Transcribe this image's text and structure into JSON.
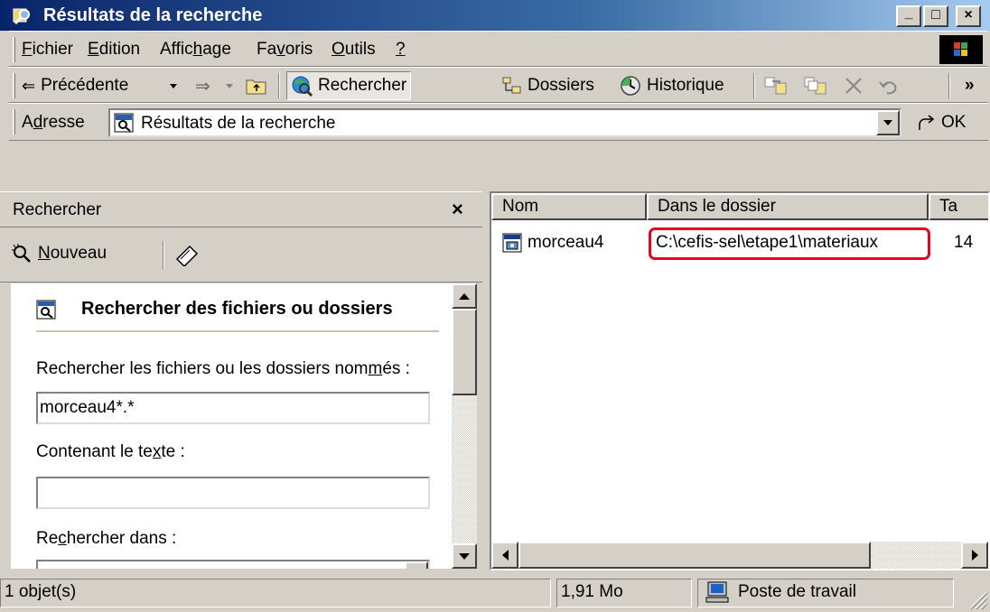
{
  "window": {
    "title": "Résultats de la recherche",
    "controls": {
      "minimize": "_",
      "maximize": "□",
      "close": "×"
    }
  },
  "menu": {
    "items": [
      {
        "accel": "F",
        "rest": "ichier"
      },
      {
        "accel": "E",
        "rest": "dition"
      },
      {
        "before": "Affic",
        "accel": "h",
        "rest": "age"
      },
      {
        "before": "Fa",
        "accel": "v",
        "rest": "oris"
      },
      {
        "accel": "O",
        "rest": "utils"
      },
      {
        "accel": "?",
        "rest": ""
      }
    ]
  },
  "toolbar": {
    "back_label": "Précédente",
    "search_label": "Rechercher",
    "folders_label": "Dossiers",
    "history_label": "Historique",
    "more": "»"
  },
  "address": {
    "label_accel": "d",
    "label_before": "A",
    "label_rest": "resse",
    "value": "Résultats de la recherche",
    "go_label": "OK"
  },
  "search_pane": {
    "title": "Rechercher",
    "close": "×",
    "new_accel": "N",
    "new_rest": "ouveau",
    "heading": "Rechercher des fichiers ou dossiers",
    "name_label_before": "Rechercher les fichiers ou les dossiers nom",
    "name_label_accel": "m",
    "name_label_after": "és :",
    "name_value": "morceau4*.*",
    "text_label_before": "Contenant le te",
    "text_label_accel": "x",
    "text_label_after": "te :",
    "text_value": "",
    "lookin_label_before": "Re",
    "lookin_label_accel": "c",
    "lookin_label_after": "hercher dans :"
  },
  "results": {
    "columns": [
      "Nom",
      "Dans le dossier",
      "Ta"
    ],
    "rows": [
      {
        "name": "morceau4",
        "folder": "C:\\cefis-sel\\etape1\\materiaux",
        "size": "14"
      }
    ],
    "highlight_color": "#e8001c"
  },
  "status": {
    "count": "1 objet(s)",
    "size": "1,91 Mo",
    "zone": "Poste de travail"
  }
}
